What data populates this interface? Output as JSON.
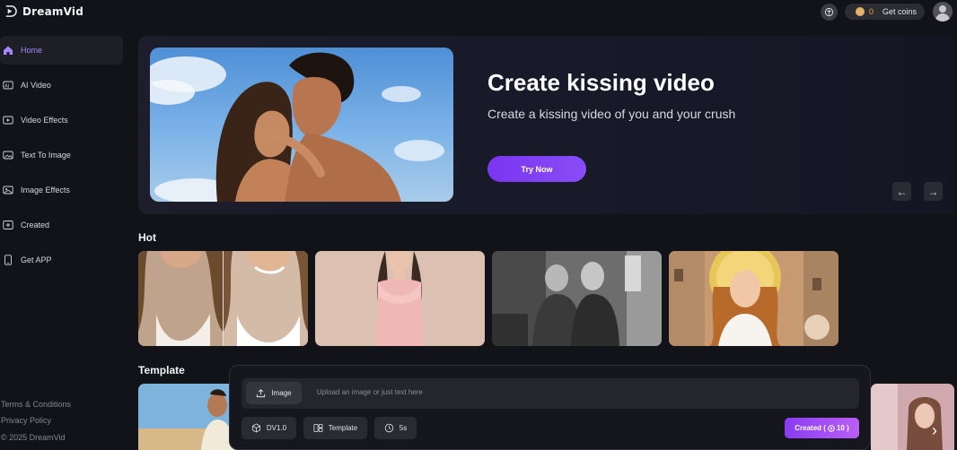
{
  "app": {
    "name": "DreamVid"
  },
  "header": {
    "coins": "0",
    "get_coins_label": "Get coins"
  },
  "sidebar": {
    "items": [
      {
        "label": "Home",
        "icon": "home-icon",
        "active": true
      },
      {
        "label": "AI Video",
        "icon": "ai-video-icon"
      },
      {
        "label": "Video Effects",
        "icon": "video-effects-icon"
      },
      {
        "label": "Text To Image",
        "icon": "text-to-image-icon"
      },
      {
        "label": "Image Effects",
        "icon": "image-effects-icon"
      },
      {
        "label": "Created",
        "icon": "created-icon"
      },
      {
        "label": "Get APP",
        "icon": "phone-icon"
      }
    ],
    "footer": {
      "terms": "Terms & Conditions",
      "privacy": "Privacy Policy",
      "copyright": "© 2025 DreamVid"
    }
  },
  "hero": {
    "title": "Create kissing video",
    "subtitle": "Create a kissing video of you and your crush",
    "cta": "Try Now"
  },
  "sections": {
    "hot": "Hot",
    "template": "Template"
  },
  "composer": {
    "image_button": "Image",
    "placeholder": "Upload an image or just text here",
    "model": "DV1.0",
    "template": "Template",
    "duration": "5s",
    "create_label": "Created ( ",
    "create_cost": "10",
    "create_suffix": " )"
  },
  "colors": {
    "accent": "#8a4cf7",
    "active_nav": "#a685ff",
    "coins": "#e8a34c"
  }
}
